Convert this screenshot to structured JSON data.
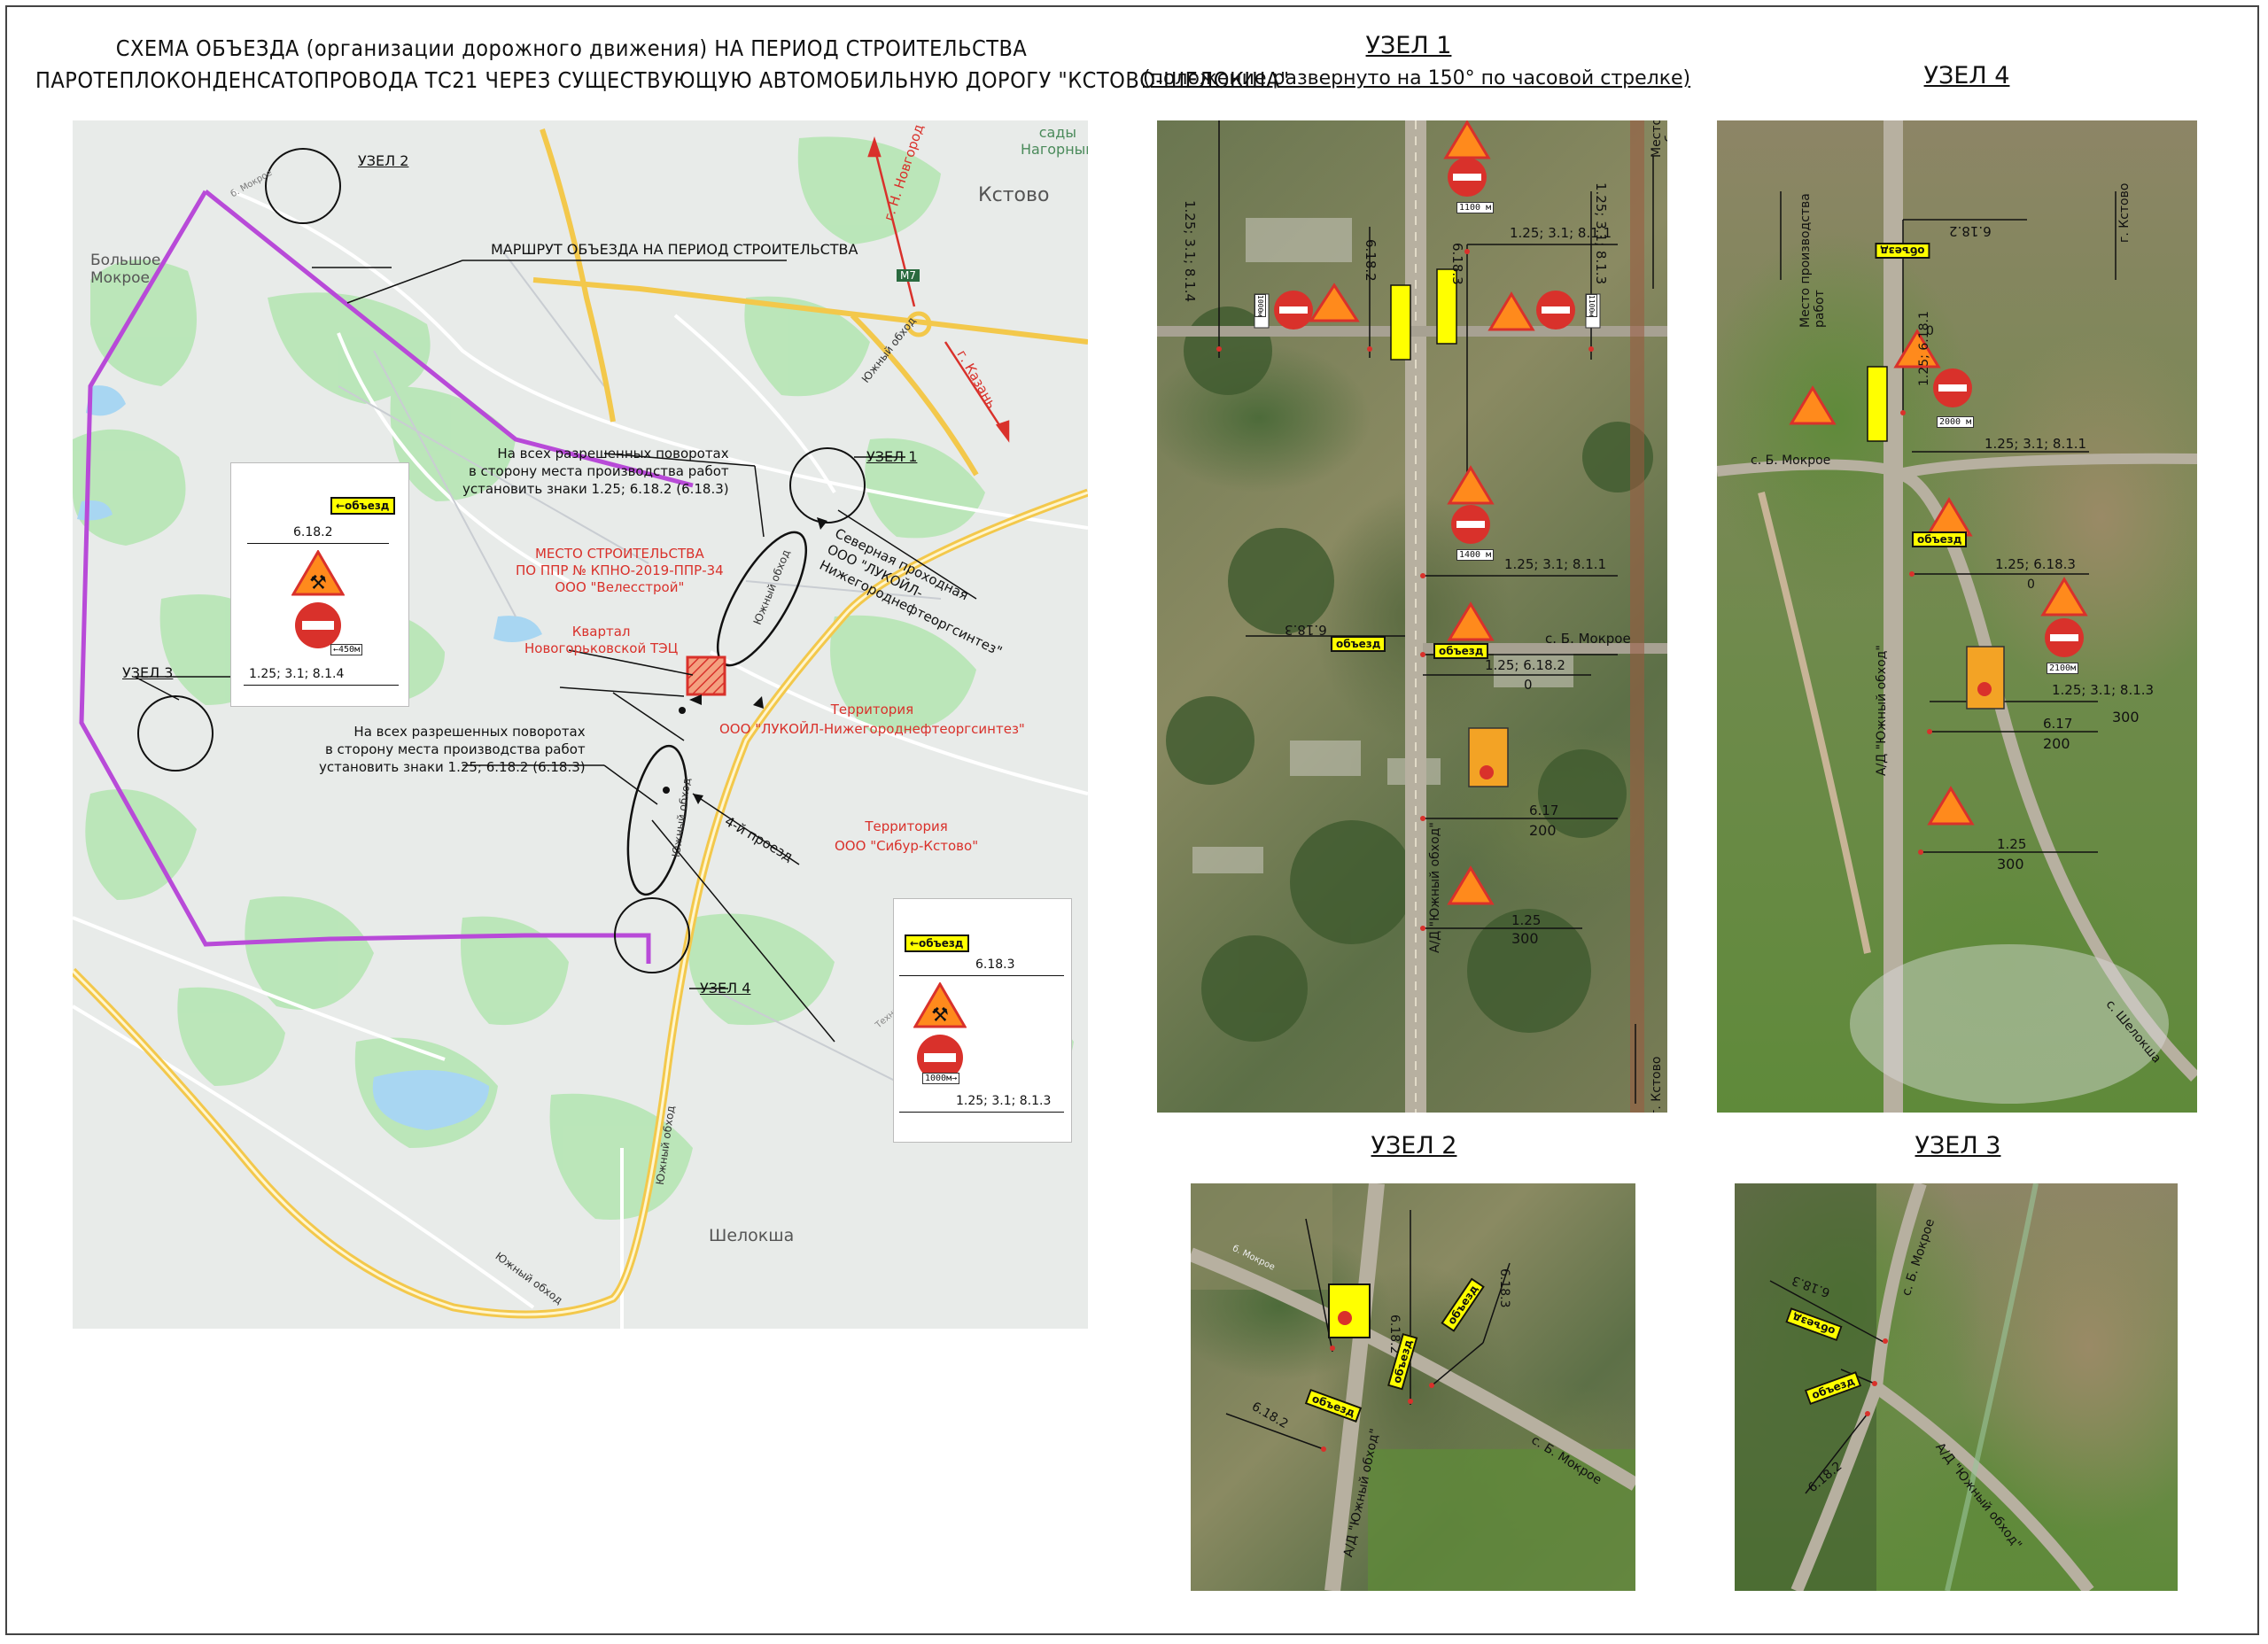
{
  "title": {
    "line1": "СХЕМА ОБЪЕЗДА (организации дорожного движения) НА ПЕРИОД СТРОИТЕЛЬСТВА",
    "line2": "ПАРОТЕПЛОКОНДЕНСАТОПРОВОДА ТС21 ЧЕРЕЗ СУЩЕСТВУЮЩУЮ АВТОМОБИЛЬНУЮ ДОРОГУ \"КСТОВО-ШЕЛОКША\""
  },
  "main_map": {
    "places": {
      "bolshoe_mokroe": "Большое\nМокрое",
      "kstovo": "Кстово",
      "sady": "сады\nНагорный",
      "shelokcha": "Шелокша",
      "m7": "М7",
      "to_nnovgorod": "г. Н. Новгород",
      "to_kazan": "г. Казань",
      "b_mokroe_road": "б. Мокрое",
      "south_bypass": "Южный обход",
      "tekhnicheskaya": "Техническая"
    },
    "nodes": {
      "n1": "УЗЕЛ 1",
      "n2": "УЗЕЛ 2",
      "n3": "УЗЕЛ 3",
      "n4": "УЗЕЛ 4"
    },
    "route_label": "МАРШРУТ ОБЪЕЗДА НА ПЕРИОД СТРОИТЕЛЬСТВА",
    "note_top": "На всех разрешенных поворотах\nв сторону места производства работ\nустановить знаки 1.25; 6.18.2 (6.18.3)",
    "note_mid": "На всех разрешенных поворотах\nв сторону места производства работ\nустановить знаки 1.25; 6.18.2 (6.18.3)",
    "construction_site": "МЕСТО СТРОИТЕЛЬСТВА\nПО ППР № КПНО-2019-ППР-34\nООО \"Велесстрой\"",
    "kvartal": "Квартал\nНовогорьковской ТЭЦ",
    "north_entrance": "Северная проходная\nООО \"ЛУКОЙЛ-\nНижегороднефтеоргсинтез\"",
    "territory1": "Территория\nООО \"ЛУКОЙЛ-Нижегороднефтеоргсинтез\"",
    "territory2": "Территория\nООО \"Сибур-Кстово\"",
    "proezd": "4-й проезд",
    "legend1": {
      "detour": "←объезд",
      "s1": "6.18.2",
      "dist": "←450м",
      "s2": "1.25; 3.1; 8.1.4"
    },
    "legend2": {
      "detour": "←объезд",
      "s1": "6.18.3",
      "dist": "1000м→",
      "s2": "1.25; 3.1; 8.1.3"
    }
  },
  "node1": {
    "title": "УЗЕЛ 1",
    "subtitle": "(положение развернуто на 150° по часовой стрелке)",
    "labels": {
      "a": "1.25; 3.1; 8.1.4",
      "b": "6.18.2",
      "c": "6.18.3",
      "d": "1.25; 3.1; 8.1.3",
      "e": "Место производства\nработ",
      "f": "1100 м",
      "g": "1.25; 3.1; 8.1.1",
      "h": "1400 м",
      "i": "1.25; 3.1; 8.1.1",
      "j": "6.18.3",
      "k": "1.25; 6.18.2",
      "l": "0",
      "m": "с. Б. Мокрое",
      "n": "6.17",
      "o": "200",
      "p": "1.25",
      "q": "300",
      "r": "А/Д \"Южный обход\"",
      "s": "г. Кстово",
      "t": "1000м",
      "u": "1100м"
    },
    "detour": "объезд"
  },
  "node4": {
    "title": "УЗЕЛ 4",
    "labels": {
      "a": "6.18.2",
      "b": "Место производства\nработ",
      "c": "г. Кстово",
      "d": "1.25; 6.18.1",
      "e": "0",
      "f": "2000 м",
      "g": "1.25; 3.1; 8.1.1",
      "h": "с. Б. Мокрое",
      "i": "1.25; 6.18.3",
      "j": "0",
      "k": "2100м",
      "l": "1.25; 3.1; 8.1.3",
      "m": "300",
      "n": "6.17",
      "o": "200",
      "p": "1.25",
      "q": "300",
      "r": "А/Д \"Южный обход\"",
      "s": "с. Шелокша"
    },
    "detour": "объезд"
  },
  "node2": {
    "title": "УЗЕЛ 2",
    "labels": {
      "a": "6.18.2",
      "b": "6.18.3",
      "c": "6.18.2",
      "d": "с. Б. Мокрое",
      "e": "А/Д \"Южный обход\"",
      "f": "б. Мокрое"
    },
    "detour": "объезд"
  },
  "node3": {
    "title": "УЗЕЛ 3",
    "labels": {
      "a": "6.18.3",
      "b": "с. Б. Мокрое",
      "c": "6.18.2",
      "d": "А/Д \"Южный обход\""
    },
    "detour": "объезд"
  },
  "colors": {
    "route": "#b84ad8",
    "sign_red": "#d9312b",
    "sign_yellow": "#ffff00",
    "road": "#f3c84b"
  }
}
